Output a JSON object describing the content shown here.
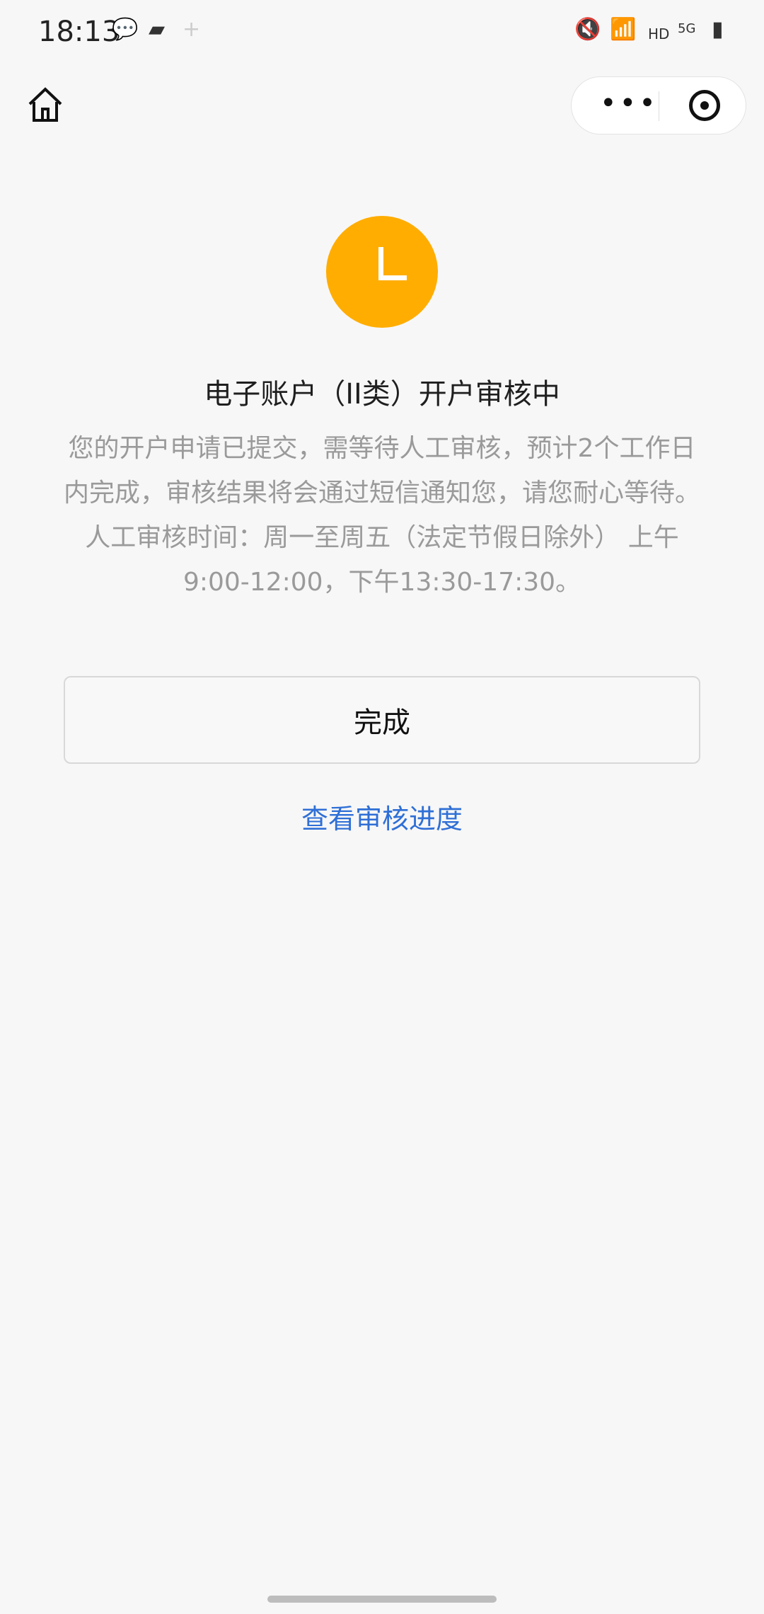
{
  "status_bar": {
    "time": "18:13",
    "network": "HD",
    "signal": "5G"
  },
  "header": {
    "home_icon": "home-icon",
    "more_icon": "more-icon",
    "close_icon": "target-icon"
  },
  "main": {
    "icon": "clock-icon",
    "title": "电子账户（II类）开户审核中",
    "description": "您的开户申请已提交，需等待人工审核，预计2个工作日内完成，审核结果将会通过短信通知您，请您耐心等待。人工审核时间：周一至周五（法定节假日除外） 上午9:00-12:00，下午13:30-17:30。",
    "done_button": "完成",
    "progress_link": "查看审核进度",
    "accent_color": "#ffad00",
    "link_color": "#2f6fd6"
  }
}
